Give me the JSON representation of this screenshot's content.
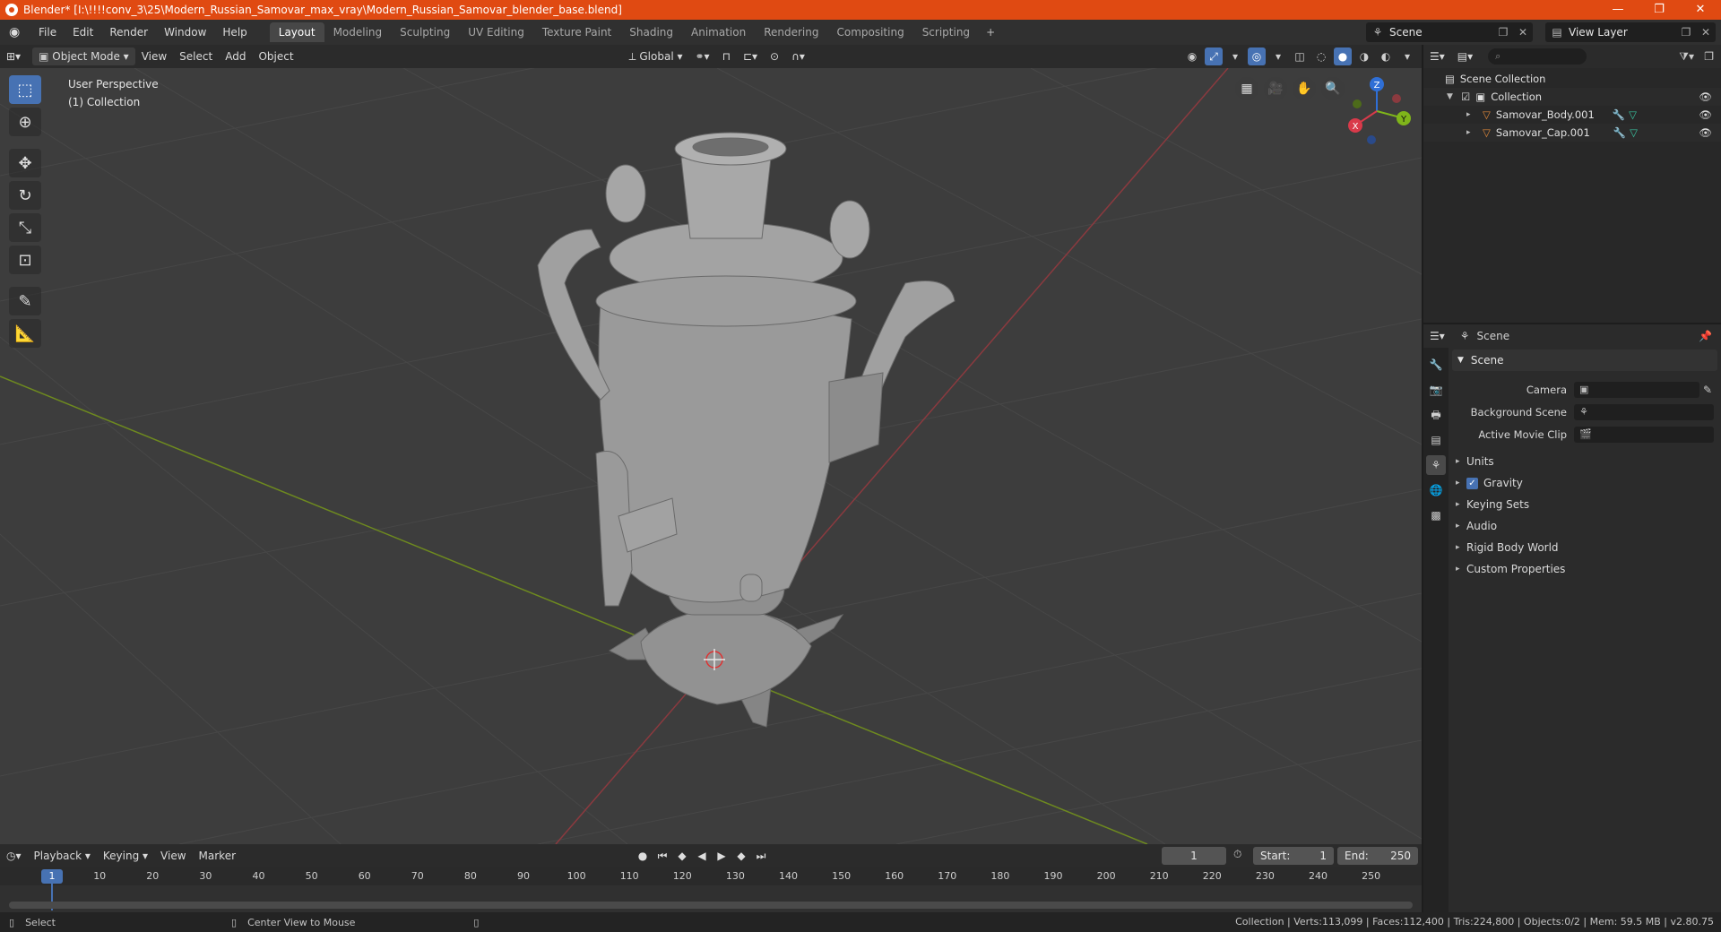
{
  "window": {
    "title": "Blender* [I:\\!!!!conv_3\\25\\Modern_Russian_Samovar_max_vray\\Modern_Russian_Samovar_blender_base.blend]",
    "controls": [
      "—",
      "❐",
      "✕"
    ]
  },
  "menu": [
    "File",
    "Edit",
    "Render",
    "Window",
    "Help"
  ],
  "workspaces": {
    "tabs": [
      "Layout",
      "Modeling",
      "Sculpting",
      "UV Editing",
      "Texture Paint",
      "Shading",
      "Animation",
      "Rendering",
      "Compositing",
      "Scripting"
    ],
    "active": "Layout",
    "add": "+"
  },
  "scene_selector": {
    "value": "Scene"
  },
  "view_layer_selector": {
    "value": "View Layer"
  },
  "viewport_header": {
    "mode": "Object Mode",
    "menus": [
      "View",
      "Select",
      "Add",
      "Object"
    ],
    "transform_orientation": "Global"
  },
  "viewport": {
    "perspective": "User Perspective",
    "collection": "(1) Collection",
    "grid_color": "#474747",
    "x_axis_color": "#8b3a3f",
    "y_axis_color": "#6e8a1f"
  },
  "outliner": {
    "search_placeholder": "",
    "rows": [
      {
        "label": "Scene Collection"
      },
      {
        "label": "Collection"
      },
      {
        "label": "Samovar_Body.001"
      },
      {
        "label": "Samovar_Cap.001"
      }
    ]
  },
  "properties": {
    "context": "Scene",
    "panel": "Scene",
    "fields": [
      {
        "label": "Camera"
      },
      {
        "label": "Background Scene"
      },
      {
        "label": "Active Movie Clip"
      }
    ],
    "subpanels": [
      "Units",
      "Gravity",
      "Keying Sets",
      "Audio",
      "Rigid Body World",
      "Custom Properties"
    ],
    "gravity_checked": true
  },
  "timeline": {
    "menus": [
      "Playback",
      "Keying",
      "View",
      "Marker"
    ],
    "current_frame": "1",
    "start_label": "Start:",
    "start": "1",
    "end_label": "End:",
    "end": "250",
    "ruler": [
      "1",
      "10",
      "20",
      "30",
      "40",
      "50",
      "60",
      "70",
      "80",
      "90",
      "100",
      "110",
      "120",
      "130",
      "140",
      "150",
      "160",
      "170",
      "180",
      "190",
      "200",
      "210",
      "220",
      "230",
      "240",
      "250"
    ]
  },
  "statusbar": {
    "left1": "Select",
    "left2": "Center View to Mouse",
    "right": "Collection | Verts:113,099 | Faces:112,400 | Tris:224,800 | Objects:0/2 | Mem: 59.5 MB | v2.80.75"
  },
  "colors": {
    "accent": "#4772b3",
    "titlebar": "#e04a12"
  }
}
